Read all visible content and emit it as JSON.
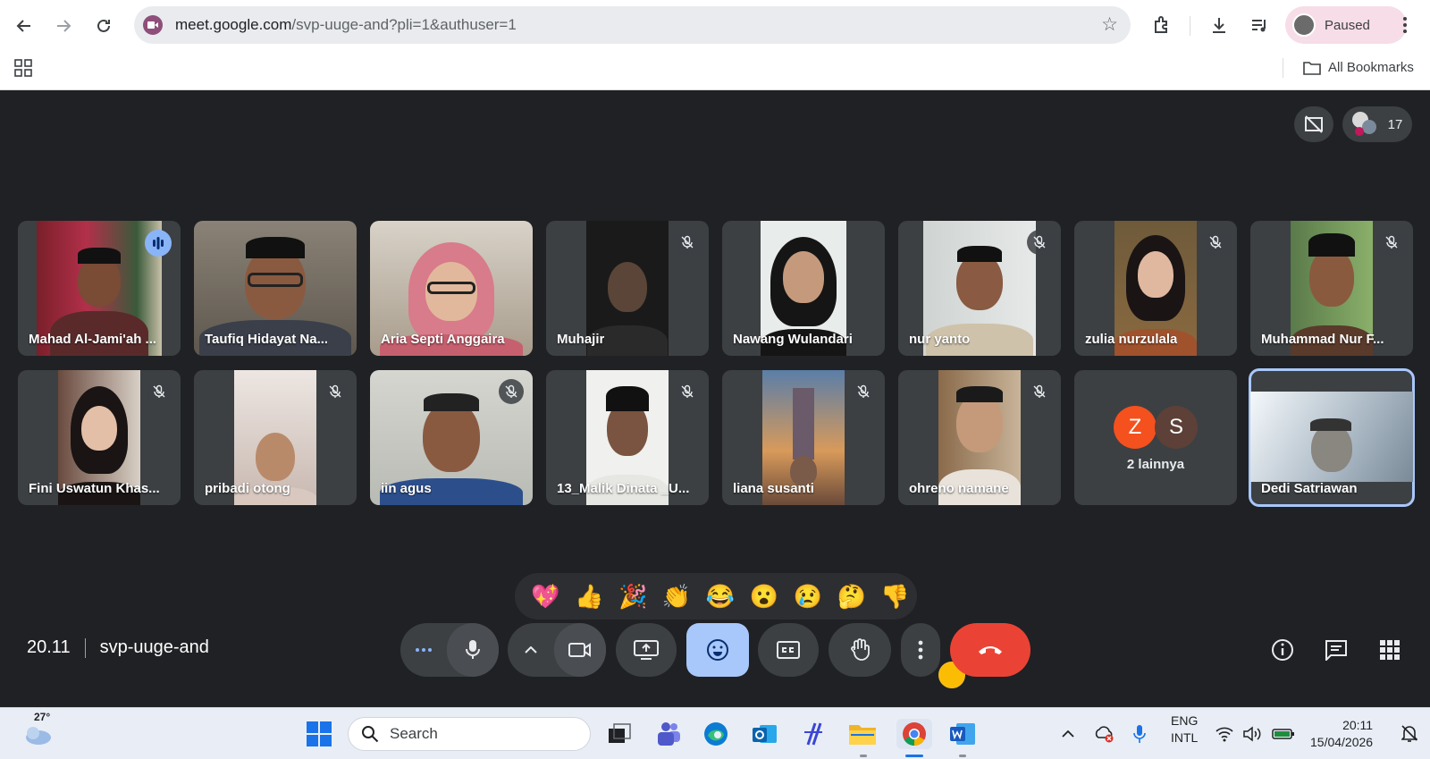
{
  "browser": {
    "url_host": "meet.google.com",
    "url_path": "/svp-uuge-and?pli=1&authuser=1",
    "profile_status": "Paused",
    "all_bookmarks": "All Bookmarks"
  },
  "meet": {
    "participant_count": "17",
    "participants": [
      {
        "name": "Mahad Al-Jami'ah ...",
        "muted": false,
        "speaking": true
      },
      {
        "name": "Taufiq Hidayat Na...",
        "muted": false,
        "speaking": false
      },
      {
        "name": "Aria Septi Anggaira",
        "muted": false,
        "speaking": false
      },
      {
        "name": "Muhajir",
        "muted": true
      },
      {
        "name": "Nawang Wulandari",
        "muted": false
      },
      {
        "name": "nur yanto",
        "muted": true
      },
      {
        "name": "zulia nurzulala",
        "muted": true
      },
      {
        "name": "Muhammad Nur F...",
        "muted": true
      },
      {
        "name": "Fini Uswatun Khas...",
        "muted": true
      },
      {
        "name": "pribadi otong",
        "muted": true
      },
      {
        "name": "iin agus",
        "muted": true
      },
      {
        "name": "13_Malik Dinata _U...",
        "muted": true
      },
      {
        "name": "liana susanti",
        "muted": true
      },
      {
        "name": "ohreno namane",
        "muted": true
      },
      {
        "name": "Dedi Satriawan",
        "muted": false,
        "selected": true
      }
    ],
    "others": {
      "initials": [
        "Z",
        "S"
      ],
      "label": "2 lainnya"
    },
    "reactions": [
      "💖",
      "👍",
      "🎉",
      "👏",
      "😂",
      "😮",
      "😢",
      "🤔",
      "👎"
    ],
    "time": "20.11",
    "meeting_code": "svp-uuge-and"
  },
  "taskbar": {
    "weather_temp": "27°",
    "search_placeholder": "Search",
    "lang_line1": "ENG",
    "lang_line2": "INTL",
    "clock_time": "20:11",
    "clock_date": "15/04/2026"
  }
}
